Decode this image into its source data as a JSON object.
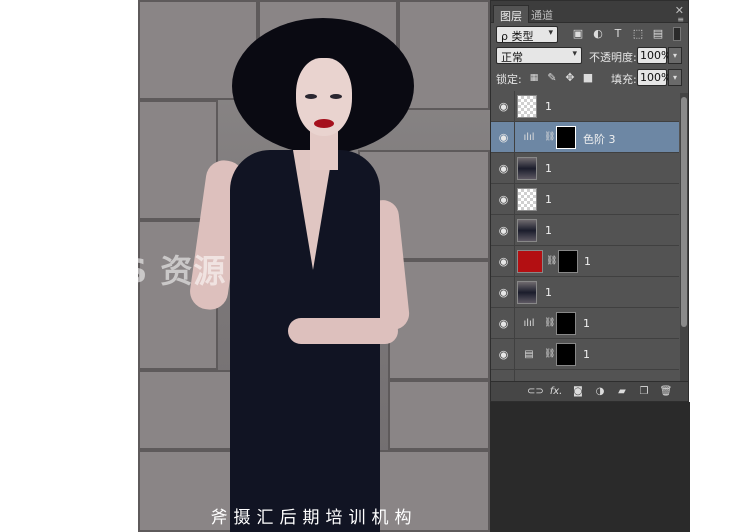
{
  "photo": {
    "watermark": "BOSS 资源",
    "caption": "斧摄汇后期培训机构"
  },
  "panel": {
    "tabs": [
      {
        "label": "图层"
      },
      {
        "label": "通道"
      }
    ],
    "close_glyph": "✕",
    "menu_glyph": "≡",
    "filter": {
      "value": "ρ 类型",
      "icons": [
        "image-filter-icon",
        "adjustment-filter-icon",
        "type-filter-icon",
        "shape-filter-icon",
        "smart-object-filter-icon"
      ]
    },
    "blend": {
      "mode": "正常",
      "opacity_label": "不透明度:",
      "opacity": "100%"
    },
    "lock": {
      "label": "锁定:",
      "fill_label": "填充:",
      "fill": "100%"
    },
    "layers": [
      {
        "name": "1",
        "thumb": "checker",
        "selected": false
      },
      {
        "name": "色阶 3",
        "thumb": "adjustment-levels",
        "mask": true,
        "selected": true
      },
      {
        "name": "1",
        "thumb": "photo",
        "selected": false
      },
      {
        "name": "1",
        "thumb": "checker",
        "selected": false
      },
      {
        "name": "1",
        "thumb": "photo",
        "selected": false
      },
      {
        "name": "1",
        "thumb": "red-fill",
        "mask": true,
        "selected": false
      },
      {
        "name": "1",
        "thumb": "photo",
        "selected": false
      },
      {
        "name": "1",
        "thumb": "adjustment-levels",
        "mask": true,
        "selected": false
      },
      {
        "name": "1",
        "thumb": "adjustment-channel",
        "mask": true,
        "selected": false
      }
    ],
    "bottom_icons": [
      "link-layers-icon",
      "fx-icon",
      "add-mask-icon",
      "new-adjustment-icon",
      "new-group-icon",
      "new-layer-icon",
      "delete-layer-icon"
    ],
    "fx_label": "fx."
  }
}
